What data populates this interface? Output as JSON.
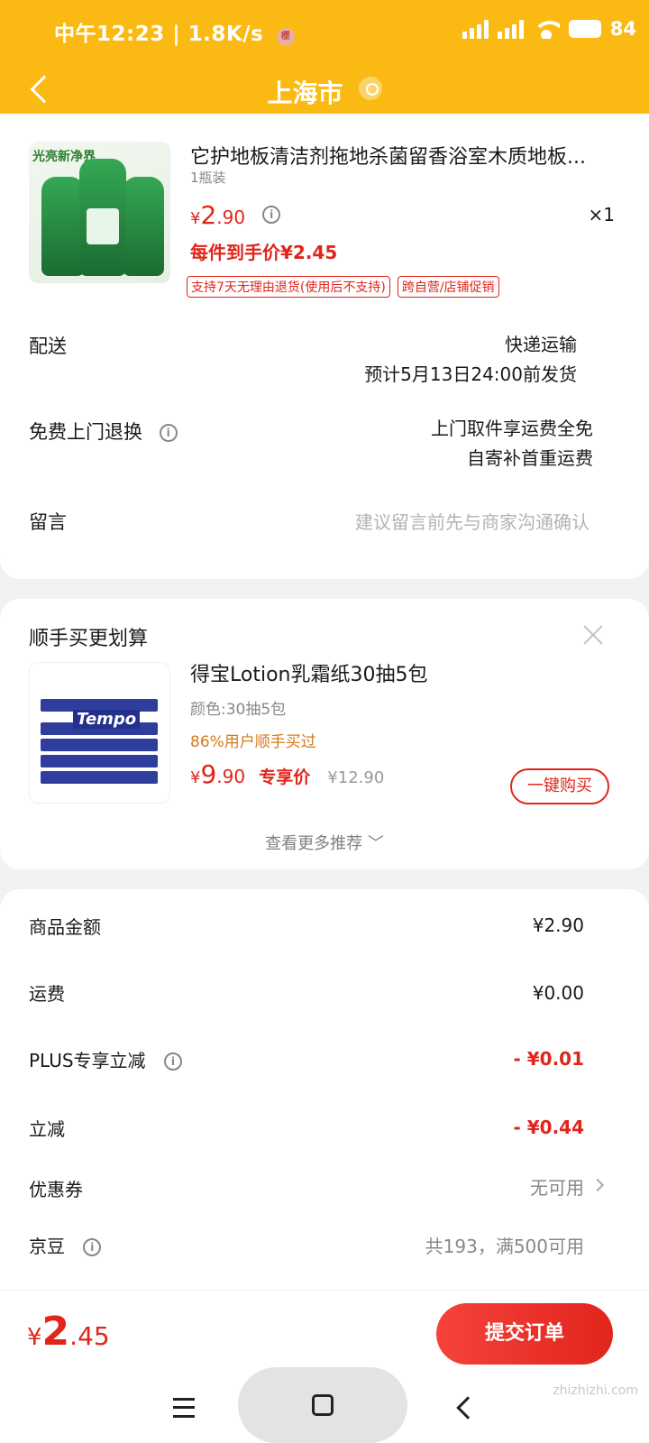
{
  "status_bar": {
    "time": "中午12:23",
    "speed": "1.8K/s",
    "net_icon": "樱",
    "battery": "84"
  },
  "nav": {
    "title": "上海市"
  },
  "product": {
    "image_tag": "光亮新净界",
    "title": "它护地板清洁剂拖地杀菌留香浴室木质地板...",
    "spec": "1瓶装",
    "price_currency": "¥",
    "price_int": "2",
    "price_dec": ".90",
    "quantity": "×1",
    "each_price": "每件到手价¥2.45",
    "badges": [
      "支持7天无理由退货(使用后不支持)",
      "跨自营/店铺促销"
    ]
  },
  "delivery": {
    "label": "配送",
    "method": "快递运输",
    "eta": "预计5月13日24:00前发货"
  },
  "return": {
    "label": "免费上门退换",
    "line1": "上门取件享运费全免",
    "line2": "自寄补首重运费"
  },
  "message": {
    "label": "留言",
    "placeholder": "建议留言前先与商家沟通确认"
  },
  "recommend": {
    "heading": "顺手买更划算",
    "brand_text": "Tempo",
    "title": "得宝Lotion乳霜纸30抽5包",
    "color": "颜色:30抽5包",
    "users": "86%用户顺手买过",
    "price_currency": "¥",
    "price_int": "9",
    "price_dec": ".90",
    "exclusive": "专享价",
    "original": "¥12.90",
    "buy_label": "一键购买",
    "more_label": "查看更多推荐 ﹀"
  },
  "summary": {
    "goods_label": "商品金额",
    "goods_value": "¥2.90",
    "shipping_label": "运费",
    "shipping_value": "¥0.00",
    "plus_label": "PLUS专享立减",
    "plus_value": "- ¥0.01",
    "discount_label": "立减",
    "discount_value": "- ¥0.44",
    "coupon_label": "优惠券",
    "coupon_value": "无可用",
    "beans_label": "京豆",
    "beans_value": "共193，满500可用"
  },
  "bottom": {
    "total_currency": "¥",
    "total_int": "2",
    "total_dec": ".45",
    "submit_label": "提交订单"
  },
  "watermark": "zhizhizhi.com",
  "colors": {
    "header": "#fbba13",
    "accent_red": "#e1251b",
    "orange_text": "#d57a1c"
  }
}
